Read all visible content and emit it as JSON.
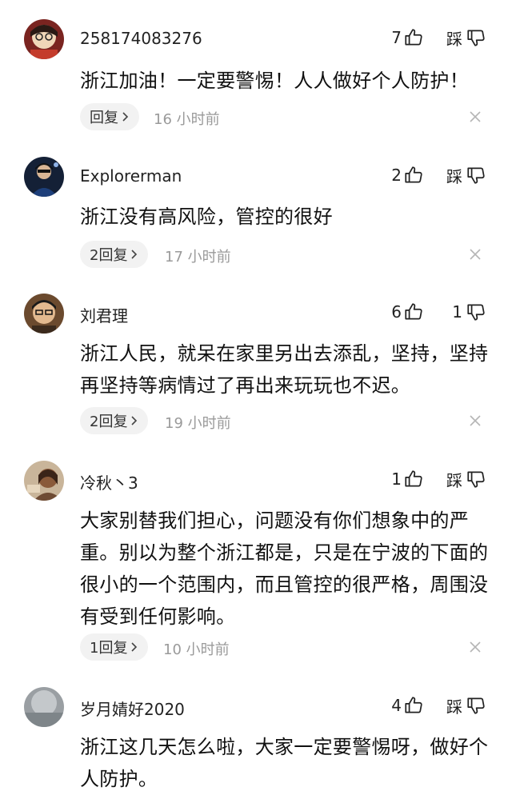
{
  "comments": [
    {
      "username": "258174083276",
      "likes": "7",
      "dislike_label": "踩",
      "text": "浙江加油！一定要警惕！人人做好个人防护！",
      "reply_label": "回复",
      "time": "16 小时前"
    },
    {
      "username": "Explorerman",
      "likes": "2",
      "dislike_label": "踩",
      "text": "浙江没有高风险，管控的很好",
      "reply_label": "2回复",
      "time": "17 小时前"
    },
    {
      "username": "刘君理",
      "likes": "6",
      "dislike_label": "1",
      "text": "浙江人民，就呆在家里另出去添乱，坚持，坚持再坚持等病情过了再出来玩玩也不迟。",
      "reply_label": "2回复",
      "time": "19 小时前"
    },
    {
      "username": "冷秋丶3",
      "likes": "1",
      "dislike_label": "踩",
      "text": "大家别替我们担心，问题没有你们想象中的严重。别以为整个浙江都是，只是在宁波的下面的很小的一个范围内，而且管控的很严格，周围没有受到任何影响。",
      "reply_label": "1回复",
      "time": "10 小时前"
    },
    {
      "username": "岁月婧好2020",
      "likes": "4",
      "dislike_label": "踩",
      "text": "浙江这几天怎么啦，大家一定要警惕呀，做好个人防护。",
      "reply_label": "",
      "time": ""
    }
  ],
  "icons": {
    "like": "thumb-up-icon",
    "dislike": "thumb-down-icon",
    "reply_arrow": "chevron-right-icon",
    "close": "close-icon"
  }
}
